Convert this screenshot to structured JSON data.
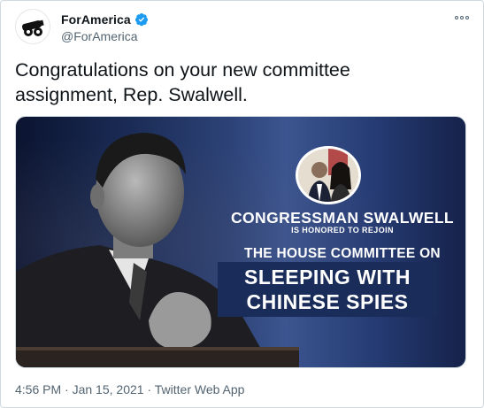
{
  "author": {
    "display_name": "ForAmerica",
    "handle": "@ForAmerica",
    "avatar_icon": "cannon-icon",
    "verified_icon": "verified-badge-icon",
    "verified_color": "#1d9bf0"
  },
  "menu": {
    "icon": "more-options-icon"
  },
  "tweet": {
    "text": "Congratulations on your new committee assignment, Rep. Swalwell."
  },
  "media": {
    "line1": "CONGRESSMAN SWALWELL",
    "line2": "IS HONORED TO REJOIN",
    "line3": "THE HOUSE COMMITTEE ON",
    "line4": "SLEEPING WITH",
    "line5": "CHINESE SPIES",
    "background_color": "#1a2b55",
    "highlight_color": "#1a2d5a"
  },
  "meta": {
    "time": "4:56 PM",
    "date": "Jan 15, 2021",
    "separator": "·",
    "source": "Twitter Web App"
  }
}
